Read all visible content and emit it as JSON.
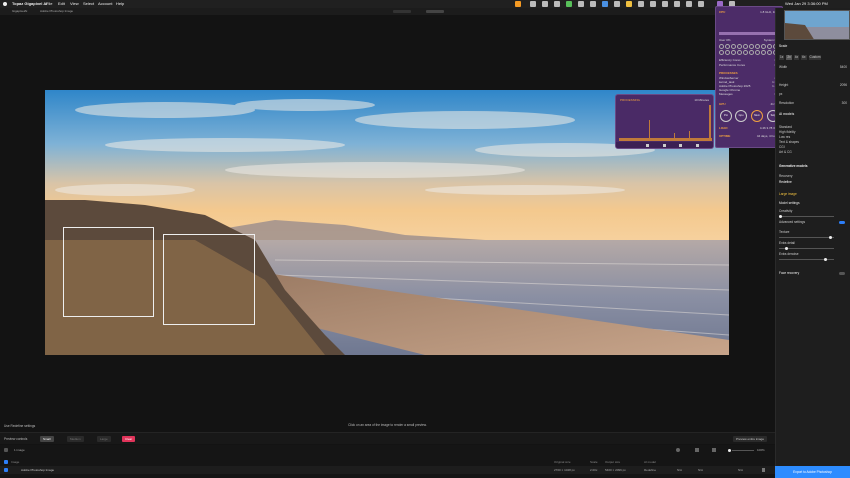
{
  "menubar": {
    "app_name": "Topaz Gigapixel AI",
    "menus": [
      "File",
      "Edit",
      "View",
      "Select",
      "Account",
      "Help"
    ],
    "clock": "Wed Jan 29  3:36:00 PM"
  },
  "titlestrip": {
    "file_name": "GigapixelAI",
    "doc_name": "Adobe Photoshop Image"
  },
  "canvas": {
    "hint": "Click on an area of the image to render a small preview."
  },
  "process_panel": {
    "title": "PROCESSING",
    "range": "10 Minutes"
  },
  "stats_panel": {
    "cpu_label": "CPU",
    "cpu_freq": "1.8 GHz, 100°",
    "user_label": "User",
    "user_val": "0%",
    "system_label": "System",
    "system_val": "0%",
    "idle_val": "0%",
    "eff_cores": "Efficiency Cores",
    "eff_val": "0%",
    "perf_cores": "Performance Cores",
    "perf_val": "0%",
    "processes_title": "PROCESSES",
    "processes": [
      {
        "name": "WindowServer",
        "value": "8%"
      },
      {
        "name": "kernel_task",
        "value": "1.3%"
      },
      {
        "name": "Adobe Photoshop 2025",
        "value": "1.1%"
      },
      {
        "name": "Google Chrome",
        "value": "1%"
      },
      {
        "name": "Messages",
        "value": "0%"
      }
    ],
    "gpu_label": "GPU",
    "gpu_val": "41.9%",
    "gauges": [
      "Pro",
      "Gpu",
      "Mem",
      "Swp"
    ],
    "load_label": "LOAD",
    "load_val": "4.46  3.78  3.48",
    "uptime_label": "UPTIME",
    "uptime_val": "44 days, 4 hours"
  },
  "right_panel": {
    "scale_label": "Scale",
    "scale_options": [
      "1x",
      "2x",
      "4x",
      "6x",
      "Custom"
    ],
    "width_label": "Width",
    "width_val": "5400",
    "height_label": "Height",
    "height_val": "2096",
    "unit": "px",
    "resolution_label": "Resolution",
    "resolution_val": "300",
    "ai_models_title": "AI models",
    "models": [
      "Standard",
      "High fidelity",
      "Low res",
      "Text & shapes",
      "CGI",
      "Art & CG"
    ],
    "generative_title": "Generative models",
    "recovery_label": "Recovery",
    "recovery_value": "Redefine",
    "creativity_label": "Creativity",
    "large_image": "Large image",
    "model_settings": "Model settings",
    "advanced_settings": "Advanced settings",
    "texture_label": "Texture",
    "prompt_label": "Extra detail",
    "denoise_label": "Extra denoise",
    "face_recovery": "Face recovery"
  },
  "toolbar": {
    "redefine_settings": "Use Redefine settings",
    "preview_label": "Preview controls",
    "small": "Small",
    "medium": "Medium",
    "large": "Large",
    "clear": "Clear",
    "preview_entire": "Preview entire image",
    "zoom": "100%"
  },
  "list": {
    "count": "1 image",
    "header": {
      "image": "Image",
      "original": "Original size",
      "scale": "Scale",
      "output": "Output size",
      "model": "AI model",
      "face": "Face",
      "recovery": "Face rec.",
      "status": "Status"
    },
    "rows": [
      {
        "name": "Adobe Photoshop Image",
        "original": "2700 × 1048 px",
        "scale": "2.00x",
        "output": "5400 × 2096 px",
        "model": "Redefine",
        "a": "N/A",
        "b": "N/A",
        "c": "N/A"
      }
    ]
  },
  "export_button": "Export to Adobe Photoshop",
  "colors": {
    "accent_blue": "#2d8cff",
    "clear_red": "#e0345a",
    "panel_purple": "#4c2c68",
    "highlight_orange": "#f0a040"
  }
}
